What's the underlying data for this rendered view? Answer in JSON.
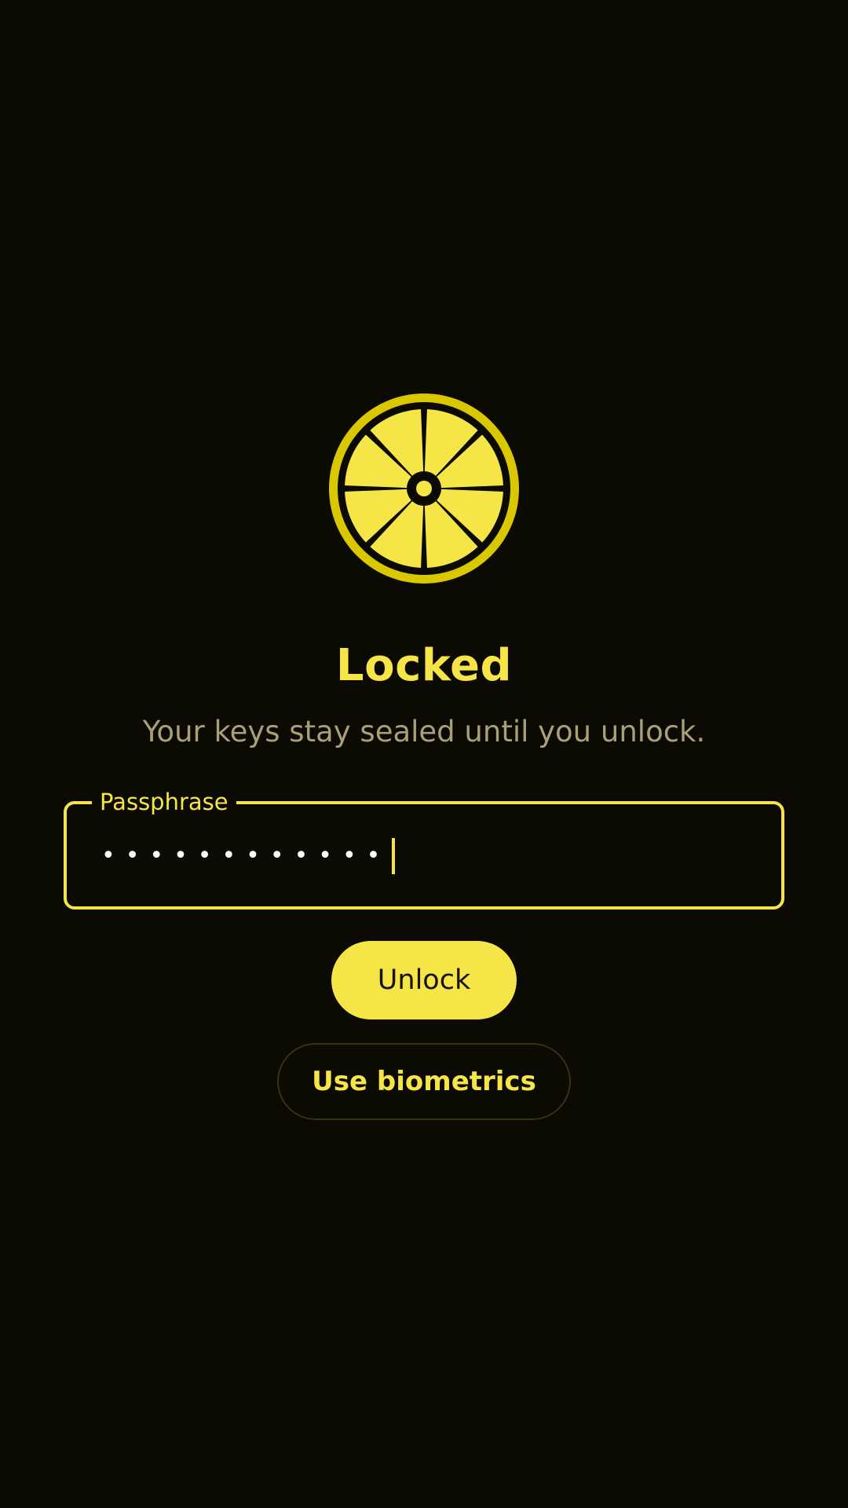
{
  "colors": {
    "background": "#0b0a03",
    "accent": "#f5e547",
    "accent_ring": "#d9c700",
    "subtitle": "#a99f79",
    "secondary_border": "#353212"
  },
  "logo": {
    "icon": "lemon-slice-icon"
  },
  "lock": {
    "title": "Locked",
    "subtitle": "Your keys stay sealed until you unlock."
  },
  "passphrase": {
    "label": "Passphrase",
    "masked_value": "••••••••••••"
  },
  "actions": {
    "unlock_label": "Unlock",
    "biometrics_label": "Use biometrics"
  }
}
